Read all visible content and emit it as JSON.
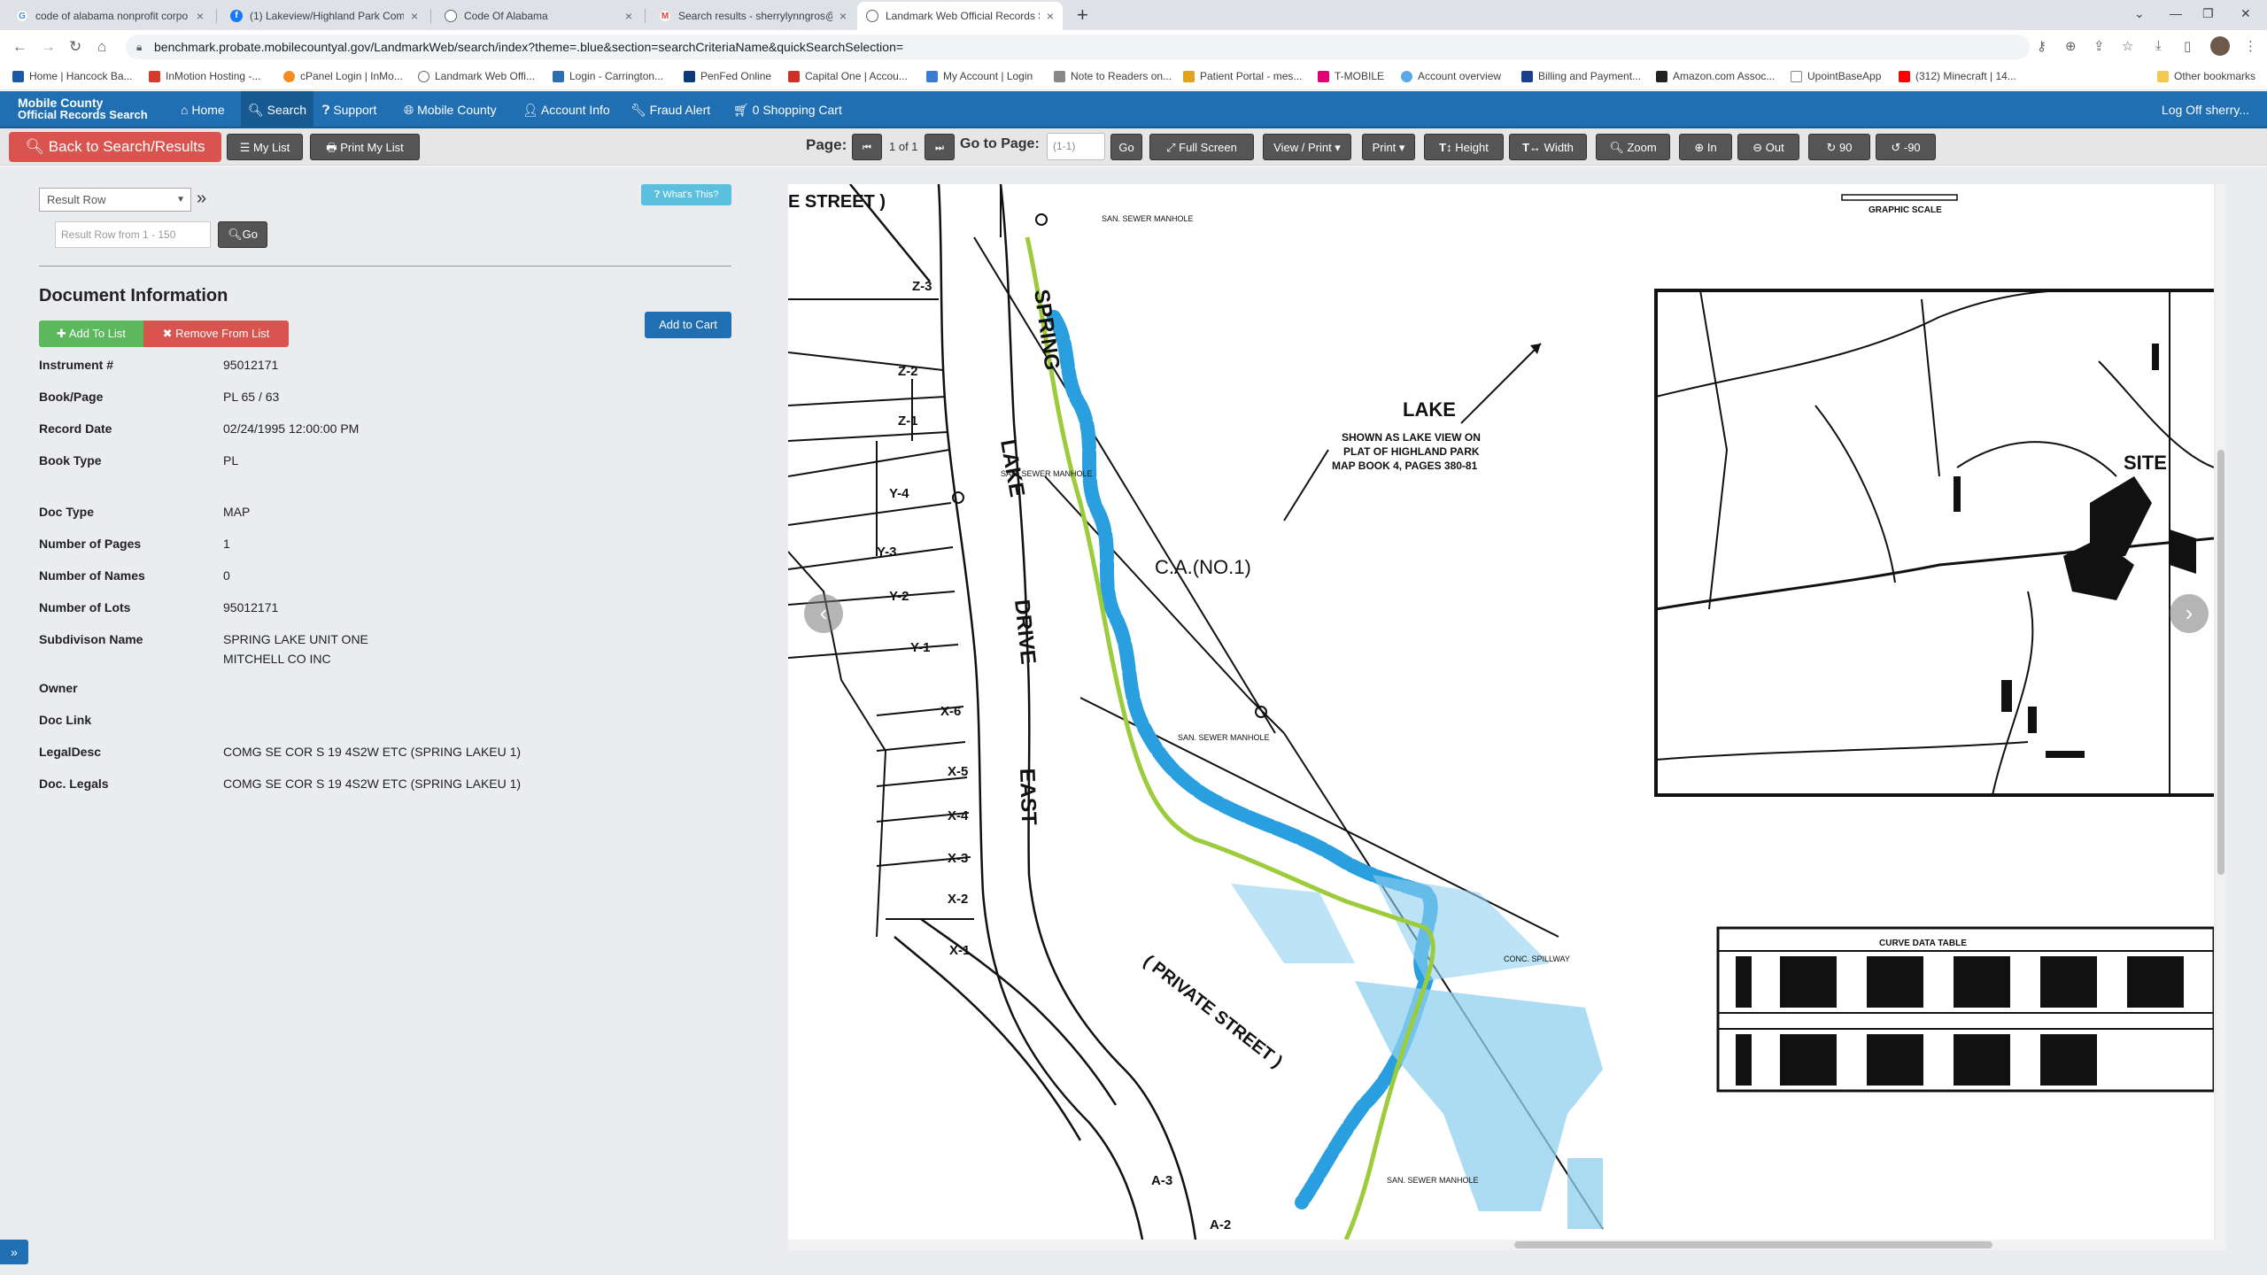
{
  "browser": {
    "tabs": [
      {
        "title": "code of alabama nonprofit corpo",
        "icon": "google-icon"
      },
      {
        "title": "(1) Lakeview/Highland Park Com",
        "icon": "facebook-icon"
      },
      {
        "title": "Code Of Alabama",
        "icon": "globe-icon"
      },
      {
        "title": "Search results - sherrylynngros@",
        "icon": "gmail-icon"
      },
      {
        "title": "Landmark Web Official Records S",
        "icon": "globe-icon"
      }
    ],
    "url": "benchmark.probate.mobilecountyal.gov/LandmarkWeb/search/index?theme=.blue&section=searchCriteriaName&quickSearchSelection=",
    "bookmarks": [
      "Home | Hancock Ba...",
      "InMotion Hosting -...",
      "cPanel Login | InMo...",
      "Landmark Web Offi...",
      "Login - Carrington...",
      "PenFed Online",
      "Capital One | Accou...",
      "My Account | Login",
      "Note to Readers on...",
      "Patient Portal - mes...",
      "T-MOBILE",
      "Account overview",
      "Billing and Payment...",
      "Amazon.com Assoc...",
      "UpointBaseApp",
      "(312) Minecraft | 14..."
    ],
    "other_bookmarks": "Other bookmarks"
  },
  "app": {
    "logo_line1": "Mobile County",
    "logo_line2": "Official Records Search",
    "menu": [
      "Home",
      "Search",
      "Support",
      "Mobile County",
      "Account Info",
      "Fraud Alert",
      "0 Shopping Cart"
    ],
    "logoff": "Log Off sherry..."
  },
  "toolbar": {
    "back": "Back to Search/Results",
    "mylist": "My List",
    "printlist": "Print My List",
    "page_label": "Page:",
    "page_of": "1 of 1",
    "goto_label": "Go to Page:",
    "goto_placeholder": "(1-1)",
    "go": "Go",
    "fullscreen": "Full Screen",
    "viewprint": "View / Print",
    "print": "Print",
    "height": "Height",
    "width": "Width",
    "zoom": "Zoom",
    "zin": "In",
    "zout": "Out",
    "rot90": "90",
    "rotm90": "-90"
  },
  "panel": {
    "result_row": "Result Row",
    "row_placeholder": "Result Row from 1 - 150",
    "go": "Go",
    "whats_this": "What's This?",
    "title": "Document Information",
    "add_to_list": "Add To List",
    "remove_from_list": "Remove From List",
    "add_to_cart": "Add to Cart",
    "fields": [
      {
        "label": "Instrument #",
        "value": "95012171"
      },
      {
        "label": "Book/Page",
        "value": "PL 65 / 63"
      },
      {
        "label": "Record Date",
        "value": "02/24/1995 12:00:00 PM"
      },
      {
        "label": "Book Type",
        "value": "PL"
      },
      {
        "label": "Doc Type",
        "value": "MAP"
      },
      {
        "label": "Number of Pages",
        "value": "1"
      },
      {
        "label": "Number of Names",
        "value": "0"
      },
      {
        "label": "Number of Lots",
        "value": "95012171"
      },
      {
        "label": "Subdivison Name",
        "value": "SPRING LAKE UNIT ONE",
        "value2": "MITCHELL CO INC"
      },
      {
        "label": "Owner",
        "value": ""
      },
      {
        "label": "Doc Link",
        "value": ""
      },
      {
        "label": "LegalDesc",
        "value": "COMG SE COR S 19 4S2W ETC (SPRING LAKEU 1)"
      },
      {
        "label": "Doc. Legals",
        "value": "COMG SE COR S 19 4S2W ETC (SPRING LAKEU 1)"
      }
    ]
  },
  "map": {
    "street_top": "E STREET )",
    "spring": "SPRING",
    "lake": "LAKE",
    "drive": "DRIVE",
    "east": "EAST",
    "private_street": "( PRIVATE STREET )",
    "lake_label": "LAKE",
    "lake_note1": "SHOWN AS LAKE VIEW ON",
    "lake_note2": "PLAT OF HIGHLAND PARK",
    "lake_note3": "MAP BOOK 4, PAGES 380-81",
    "ca": "C.A.(NO.1)",
    "site": "SITE",
    "graphic_scale": "GRAPHIC SCALE",
    "curve_table": "CURVE DATA TABLE",
    "lots": [
      "Z-3",
      "Z-2",
      "Z-1",
      "Y-4",
      "Y-3",
      "Y-2",
      "Y-1",
      "X-6",
      "X-5",
      "X-4",
      "X-3",
      "X-2",
      "X-1",
      "A-3",
      "A-2"
    ],
    "sewer": "SAN. SEWER MANHOLE",
    "spillway": "CONC. SPILLWAY",
    "colors": {
      "lake_blue": "#2a9fe0",
      "lake_light": "#8fd0f0",
      "green_line": "#9ccc3c"
    }
  }
}
